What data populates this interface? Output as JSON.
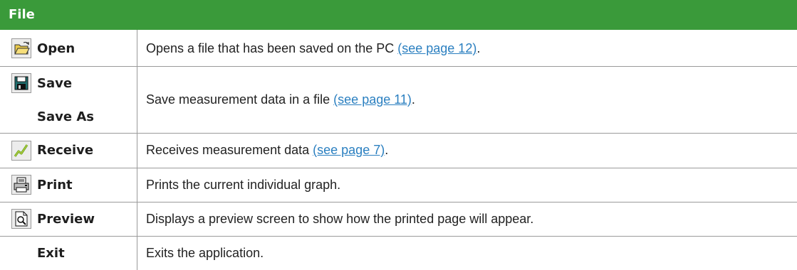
{
  "header": {
    "title": "File"
  },
  "colors": {
    "header_bg": "#3a9a3a",
    "link": "#2a7fc0",
    "divider": "#9a9a9a"
  },
  "rows": [
    {
      "icon": "open-folder-icon",
      "label": "Open",
      "desc": "Opens a file that has been saved on the PC",
      "link": "(see page 12)",
      "tail": "."
    },
    {
      "icon": "floppy-disk-icon",
      "label": "Save",
      "desc": "Save measurement data in a file",
      "link": "(see page 11)",
      "tail": "."
    },
    {
      "icon": "",
      "label": "Save As"
    },
    {
      "icon": "receive-graph-icon",
      "label": "Receive",
      "desc": "Receives measurement data",
      "link": "(see page 7)",
      "tail": "."
    },
    {
      "icon": "printer-icon",
      "label": "Print",
      "desc": "Prints the current individual graph."
    },
    {
      "icon": "print-preview-icon",
      "label": "Preview",
      "desc": "Displays a preview screen to show how the printed page will appear."
    },
    {
      "icon": "",
      "label": "Exit",
      "desc": "Exits the application."
    }
  ]
}
